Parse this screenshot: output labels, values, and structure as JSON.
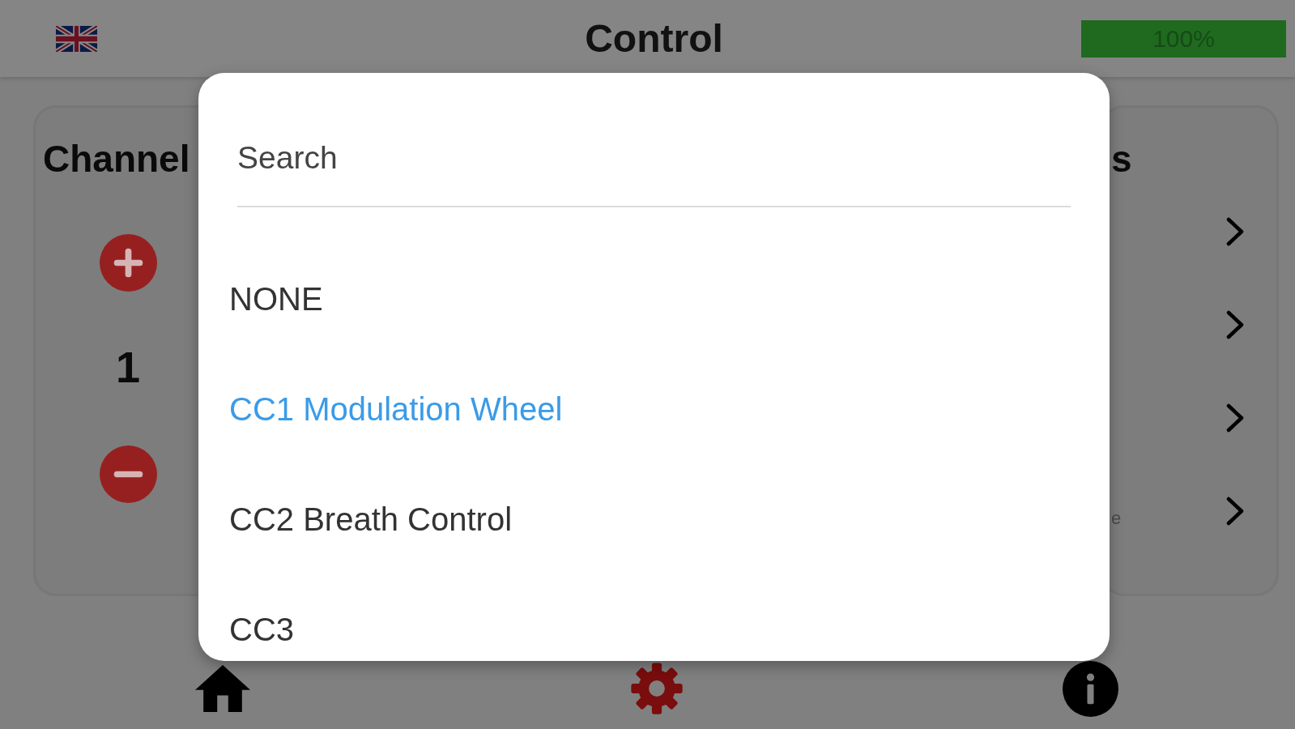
{
  "top_bar": {
    "title": "Control",
    "battery": {
      "level": 1,
      "reading": "100%"
    }
  },
  "channel_card": {
    "title": "Channel",
    "value": "1"
  },
  "right_card": {
    "title": "s",
    "rows": [
      {
        "kind": "link"
      },
      {
        "kind": "link"
      },
      {
        "kind": "link"
      },
      {
        "kind": "link",
        "caption": "e"
      }
    ]
  },
  "dropdown": {
    "search": {
      "placeholder": "Search"
    },
    "options": [
      {
        "label": "NONE",
        "selected": false
      },
      {
        "label": "CC1 Modulation Wheel",
        "selected": true
      },
      {
        "label": "CC2 Breath Control",
        "selected": false
      },
      {
        "label": "CC3",
        "selected": false
      }
    ]
  },
  "bottom_nav": [
    {
      "kind": "home",
      "selected": false
    },
    {
      "kind": "settings",
      "selected": true
    },
    {
      "kind": "info",
      "selected": false
    }
  ]
}
